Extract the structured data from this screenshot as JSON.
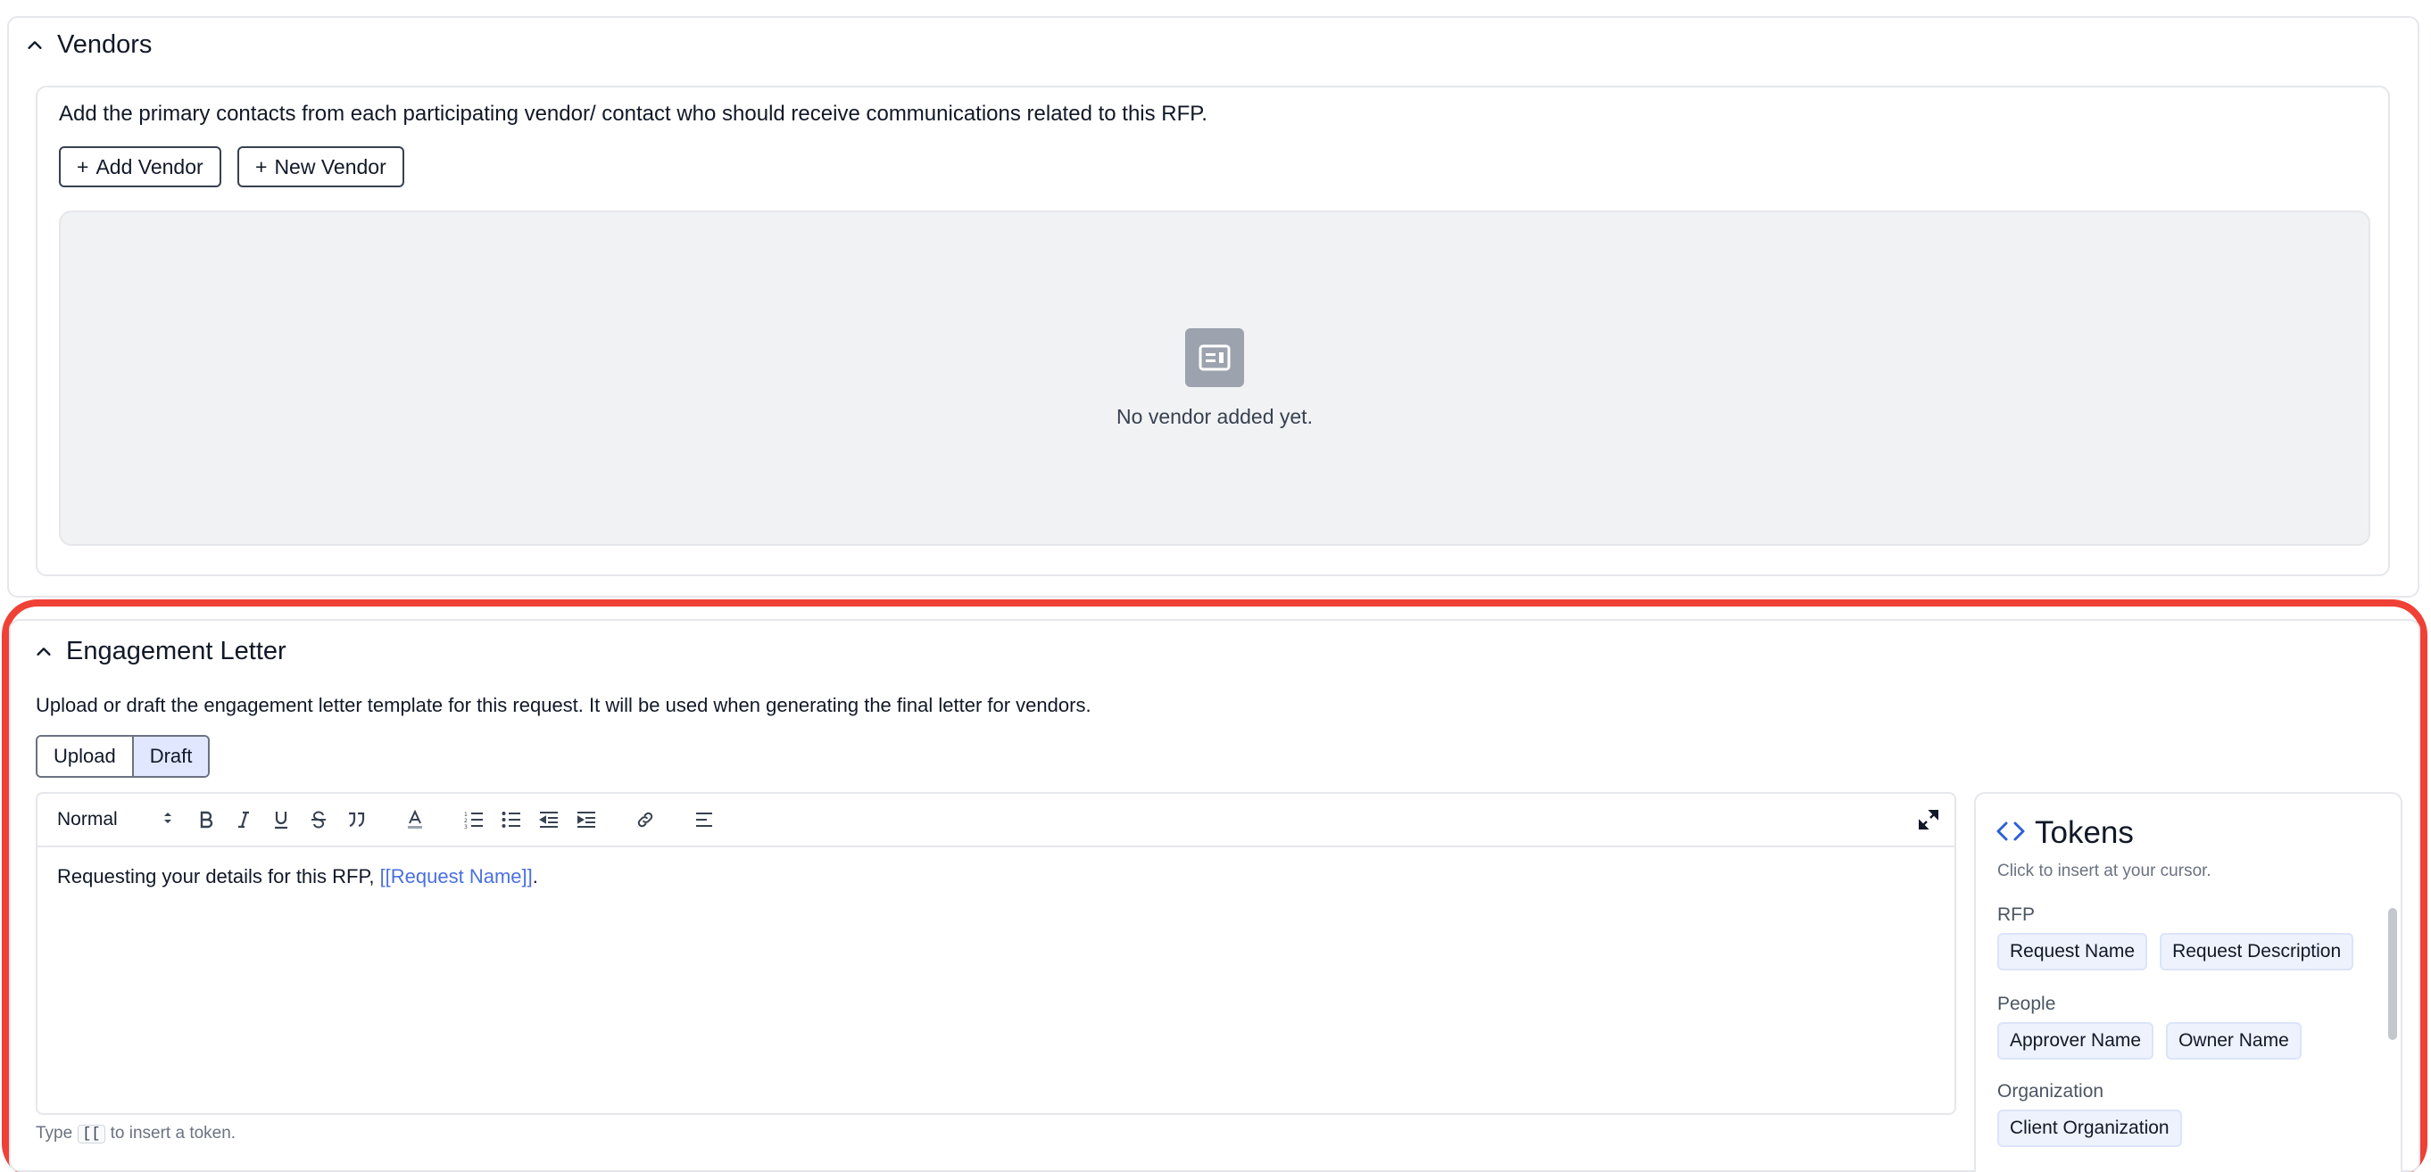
{
  "vendors": {
    "title": "Vendors",
    "description": "Add the primary contacts from each participating vendor/ contact who should receive communications related to this RFP.",
    "add_vendor_label": "Add Vendor",
    "new_vendor_label": "New Vendor",
    "empty_text": "No vendor added yet."
  },
  "engagement": {
    "title": "Engagement Letter",
    "description": "Upload or draft the engagement letter template for this request. It will be used when generating the final letter for vendors.",
    "toggle": {
      "upload": "Upload",
      "draft": "Draft",
      "active": "Draft"
    },
    "editor": {
      "block_style": "Normal",
      "body_text": "Requesting your details for this RFP, ",
      "body_token": "[[Request Name]]",
      "body_end": "."
    },
    "hint": {
      "prefix": "Type",
      "key": "[[",
      "suffix": "to insert a token."
    }
  },
  "tokens": {
    "title": "Tokens",
    "subtitle": "Click to insert at your cursor.",
    "groups": [
      {
        "label": "RFP",
        "items": [
          "Request Name",
          "Request Description"
        ]
      },
      {
        "label": "People",
        "items": [
          "Approver Name",
          "Owner Name"
        ]
      },
      {
        "label": "Organization",
        "items": [
          "Client Organization"
        ]
      }
    ]
  },
  "colors": {
    "highlight": "#ef4136",
    "accent": "#2f5fd8",
    "token_text": "#4a6fe0"
  }
}
